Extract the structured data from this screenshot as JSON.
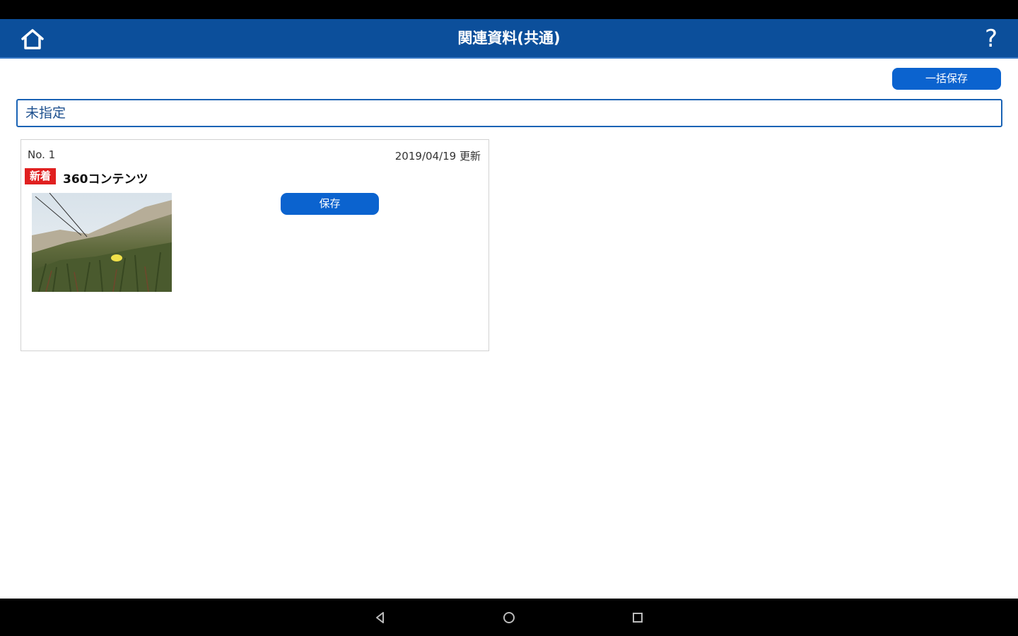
{
  "header": {
    "title": "関連資料(共通)",
    "home_icon": "home-icon",
    "help_label": "?"
  },
  "toolbar": {
    "bulk_save_label": "一括保存"
  },
  "category": {
    "selected": "未指定"
  },
  "items": [
    {
      "number": "No. 1",
      "updated": "2019/04/19 更新",
      "badge": "新着",
      "title": "360コンテンツ",
      "save_label": "保存",
      "thumbnail": "grass-hillside-photo"
    }
  ],
  "navigation": {
    "back_icon": "back-triangle-icon",
    "home_icon": "home-circle-icon",
    "recents_icon": "recents-square-icon"
  },
  "colors": {
    "header_bg": "#0c4f9b",
    "button_bg": "#0b63cf",
    "badge_bg": "#e02020",
    "select_border": "#1a63b5"
  }
}
